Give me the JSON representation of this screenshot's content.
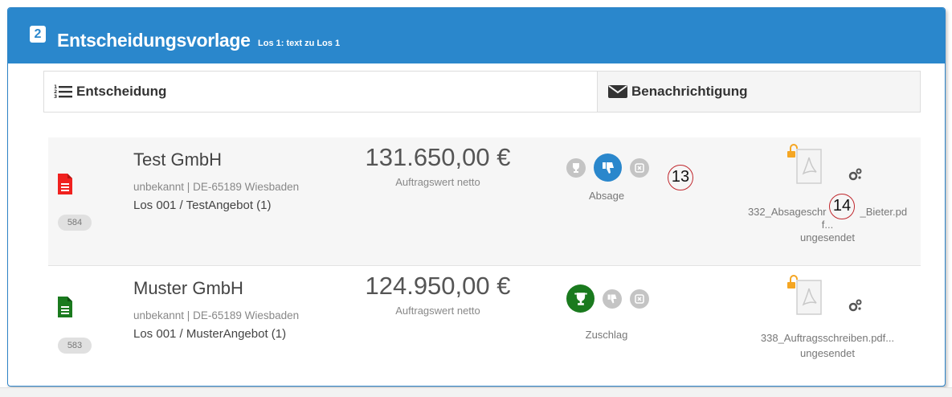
{
  "panel": {
    "step": "2",
    "title": "Entscheidungsvorlage",
    "subtitle": "Los 1: text zu Los 1"
  },
  "tabs": [
    {
      "label": "Entscheidung",
      "icon": "ordered-list-icon"
    },
    {
      "label": "Benachrichtigung",
      "icon": "envelope-icon"
    }
  ],
  "rows": [
    {
      "doc_color": "#f0211f",
      "number": "584",
      "company": "Test GmbH",
      "address": "unbekannt | DE-65189 Wiesbaden",
      "lot": "Los 001 / TestAngebot (1)",
      "amount": "131.650,00 €",
      "amount_label": "Auftragswert netto",
      "decision": "Absage",
      "callout_decision": "13",
      "file_name_line1": "332_Absageschr",
      "file_name_line1b": "_Bieter.pd",
      "file_name_line2": "f...",
      "file_status": "ungesendet",
      "callout_file": "14"
    },
    {
      "doc_color": "#1a7a1e",
      "number": "583",
      "company": "Muster GmbH",
      "address": "unbekannt | DE-65189 Wiesbaden",
      "lot": "Los 001 / MusterAngebot (1)",
      "amount": "124.950,00 €",
      "amount_label": "Auftragswert netto",
      "decision": "Zuschlag",
      "file_name_line1": "338_Auftragsschreiben.pdf...",
      "file_status": "ungesendet"
    }
  ],
  "colors": {
    "header": "#2a87cc",
    "reject_active": "#2a87cc",
    "award_active": "#1a7a1e",
    "inactive": "#c4c4c4",
    "unlock": "#f5a623"
  }
}
